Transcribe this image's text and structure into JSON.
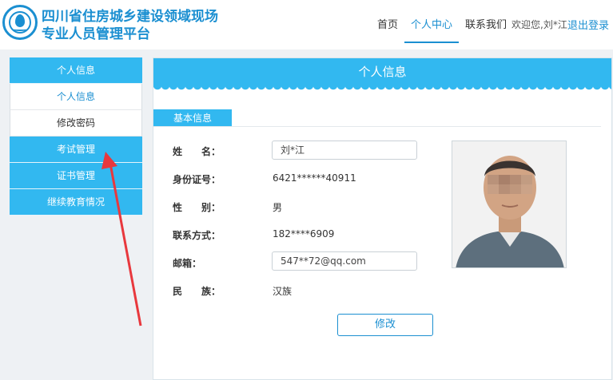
{
  "header": {
    "title_line1": "四川省住房城乡建设领域现场",
    "title_line2": "专业人员管理平台",
    "nav": {
      "home": "首页",
      "personal": "个人中心",
      "contact": "联系我们"
    },
    "welcome": "欢迎您,刘*江",
    "logout": "退出登录",
    "logo_icon": "emblem-icon"
  },
  "sidebar": {
    "personal_info": "个人信息",
    "sub_personal_info": "个人信息",
    "sub_change_password": "修改密码",
    "exam_management": "考试管理",
    "certificate_management": "证书管理",
    "continuing_education": "继续教育情况"
  },
  "panel": {
    "title": "个人信息",
    "section": "基本信息",
    "fields": {
      "name_label": "姓　　名：",
      "name_value": "刘*江",
      "id_label": "身份证号：",
      "id_value": "6421******40911",
      "gender_label": "性　　别：",
      "gender_value": "男",
      "phone_label": "联系方式：",
      "phone_value": "182****6909",
      "email_label": "邮箱：",
      "email_value": "547**72@qq.com",
      "ethnicity_label": "民　　族：",
      "ethnicity_value": "汉族"
    },
    "edit_button": "修改"
  },
  "colors": {
    "accent": "#32b8f0",
    "brand": "#1b8fd1",
    "arrow": "#e8383d"
  }
}
